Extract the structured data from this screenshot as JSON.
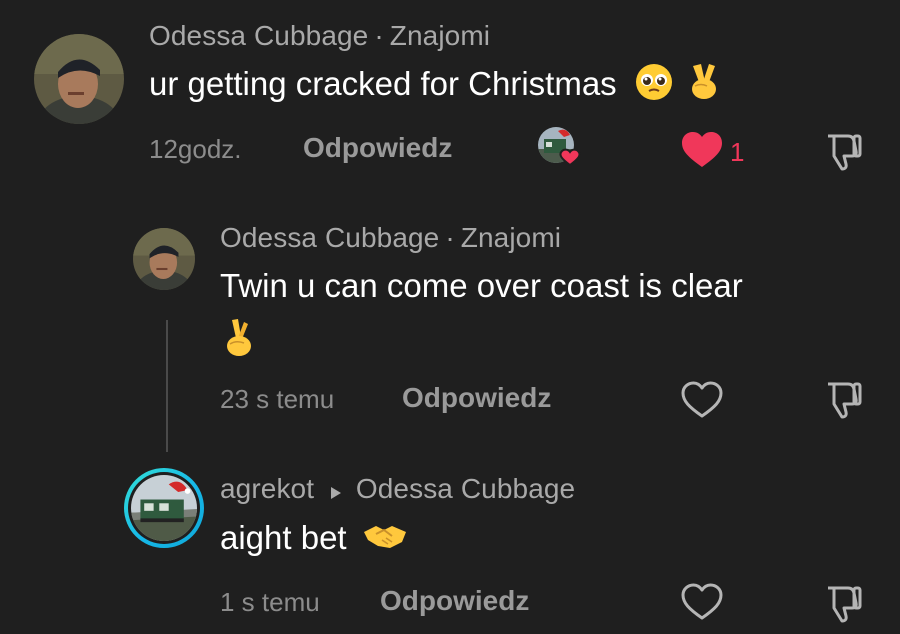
{
  "comments": [
    {
      "author": "Odessa Cubbage",
      "relation": "Znajomi",
      "text": "ur getting cracked for Christmas",
      "time": "12godz.",
      "reply_label": "Odpowiedz",
      "like_count": "1",
      "liked": true
    },
    {
      "author": "Odessa Cubbage",
      "relation": "Znajomi",
      "text": "Twin u can come over coast is clear",
      "time": "23 s temu",
      "reply_label": "Odpowiedz",
      "liked": false
    },
    {
      "author": "agrekot",
      "reply_to": "Odessa Cubbage",
      "text": "aight bet",
      "time": "1 s temu",
      "reply_label": "Odpowiedz",
      "liked": false
    }
  ],
  "icons": {
    "like_filled": "heart-filled-icon",
    "like_outline": "heart-outline-icon",
    "dislike": "thumbs-down-icon",
    "reply_arrow": "caret-right-icon",
    "emoji_pleading": "pleading-face-emoji",
    "emoji_victory": "victory-hand-emoji",
    "emoji_crossed": "crossed-fingers-emoji",
    "emoji_handshake": "handshake-emoji"
  },
  "colors": {
    "background": "#1f1f1f",
    "like_red": "#f0375a",
    "ring": "#16b8e8"
  }
}
